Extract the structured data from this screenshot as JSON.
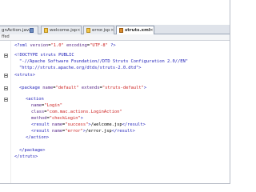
{
  "tabs": [
    {
      "label": "gnAction.java",
      "icon": "java-file-icon",
      "active": false
    },
    {
      "label": "welcome.jsp",
      "icon": "jsp-file-icon",
      "active": false
    },
    {
      "label": "error.jsp",
      "icon": "jsp-file-icon",
      "active": false
    },
    {
      "label": "struts.xml",
      "icon": "xml-file-icon",
      "active": true
    }
  ],
  "close_glyph": "×",
  "breadcrumb": "ffed",
  "code": {
    "line0": {
      "p1": "<?xml ",
      "a1": "version",
      "e1": "=",
      "v1": "\"1.0\"",
      "sp": " ",
      "a2": "encoding",
      "e2": "=",
      "v2": "\"UTF-8\"",
      "end": " ?>"
    },
    "line1": "<!DOCTYPE struts PUBLIC",
    "line2": "\"-//Apache Software Foundation//DTD Struts Configuration 2.0//EN\"",
    "line3": "\"http://struts.apache.org/dtds/struts-2.0.dtd\">",
    "line4": "<struts>",
    "line5": {
      "p1": "<package ",
      "a1": "name",
      "e1": "=",
      "v1": "\"default\"",
      "sp": " ",
      "a2": "extends",
      "e2": "=",
      "v2": "\"struts-default\"",
      "end": ">"
    },
    "line6": "<action",
    "line7": {
      "a": "name",
      "e": "=",
      "v": "\"Login\""
    },
    "line8": {
      "a": "class",
      "e": "=",
      "v": "\"com.mac.actions.LoginAction\""
    },
    "line9": {
      "a": "method",
      "e": "=",
      "v": "\"checkLogin\"",
      "end": ">"
    },
    "line10": {
      "p1": "<result ",
      "a1": "name",
      "e1": "=",
      "v1": "\"success\"",
      "mid": ">",
      "body": "/welcome.jsp",
      "end": "</result>"
    },
    "line11": {
      "p1": "<result ",
      "a1": "name",
      "e1": "=",
      "v1": "\"error\"",
      "mid": ">",
      "body": "/error.jsp",
      "end": "</result>"
    },
    "line12": "</action>",
    "line13": "</package>",
    "line14": "</struts>"
  }
}
